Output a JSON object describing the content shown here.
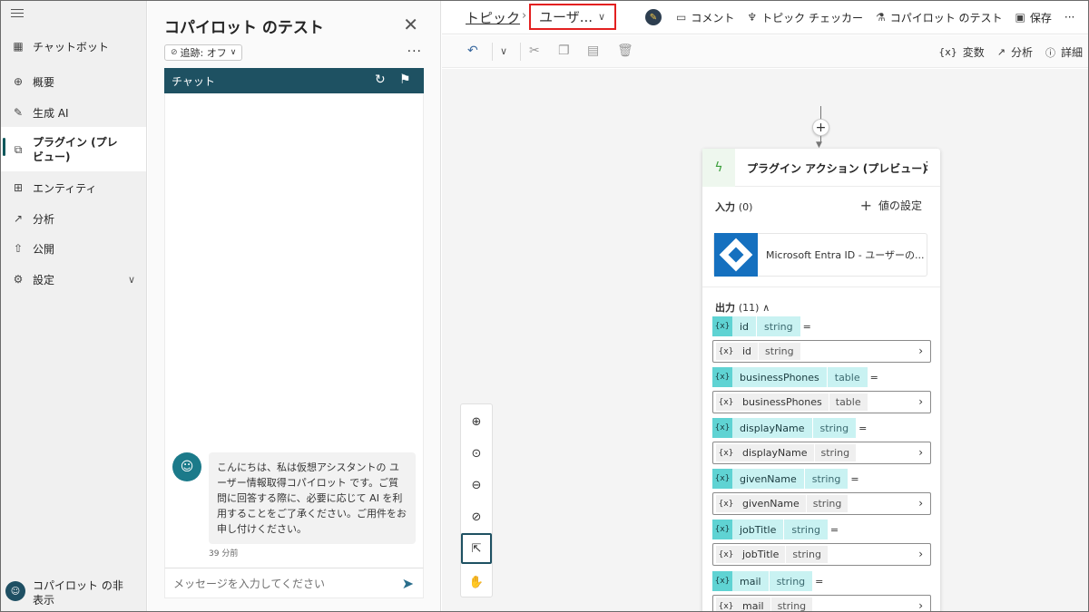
{
  "nav": {
    "items": [
      {
        "label": "チャットボット",
        "icon": "grid-icon"
      },
      {
        "label": "概要",
        "icon": "overview-icon"
      },
      {
        "label": "生成 AI",
        "icon": "magic-wand-icon"
      },
      {
        "label": "プラグイン (プレビュー)",
        "icon": "plugin-icon"
      },
      {
        "label": "エンティティ",
        "icon": "entity-icon"
      },
      {
        "label": "分析",
        "icon": "analytics-icon"
      },
      {
        "label": "公開",
        "icon": "publish-icon"
      },
      {
        "label": "設定",
        "icon": "gear-icon"
      }
    ],
    "hide_copilot": "コパイロット の非表示"
  },
  "panel": {
    "title": "コパイロット のテスト",
    "tracking": "追跡: オフ",
    "chat_header": "チャット",
    "bot_message": "こんにちは、私は仮想アシスタントの ユーザー情報取得コパイロット です。ご質問に回答する際に、必要に応じて AI を利用することをご了承ください。ご用件をお申し付けください。",
    "message_time": "39 分前",
    "input_placeholder": "メッセージを入力してください"
  },
  "topbar": {
    "crumb_topic": "トピック",
    "crumb_current": "ユーザ...",
    "actions": {
      "comment": "コメント",
      "topic_checker": "トピック チェッカー",
      "test_copilot": "コパイロット のテスト",
      "save": "保存"
    }
  },
  "toolbar": {
    "variables": "変数",
    "analytics": "分析",
    "details": "詳細"
  },
  "node": {
    "title": "プラグイン アクション (プレビュー)",
    "input_label": "入力",
    "input_count": "(0)",
    "set_value": "値の設定",
    "connector_name": "Microsoft Entra ID - ユーザーの...",
    "output_label": "出力",
    "output_count": "(11)",
    "outputs": [
      {
        "name": "id",
        "type": "string"
      },
      {
        "name": "businessPhones",
        "type": "table"
      },
      {
        "name": "displayName",
        "type": "string"
      },
      {
        "name": "givenName",
        "type": "string"
      },
      {
        "name": "jobTitle",
        "type": "string"
      },
      {
        "name": "mail",
        "type": "string"
      }
    ]
  },
  "colors": {
    "brand": "#1e5162",
    "highlight_box": "#e32020",
    "variable_chip": "#5fd3d3"
  }
}
